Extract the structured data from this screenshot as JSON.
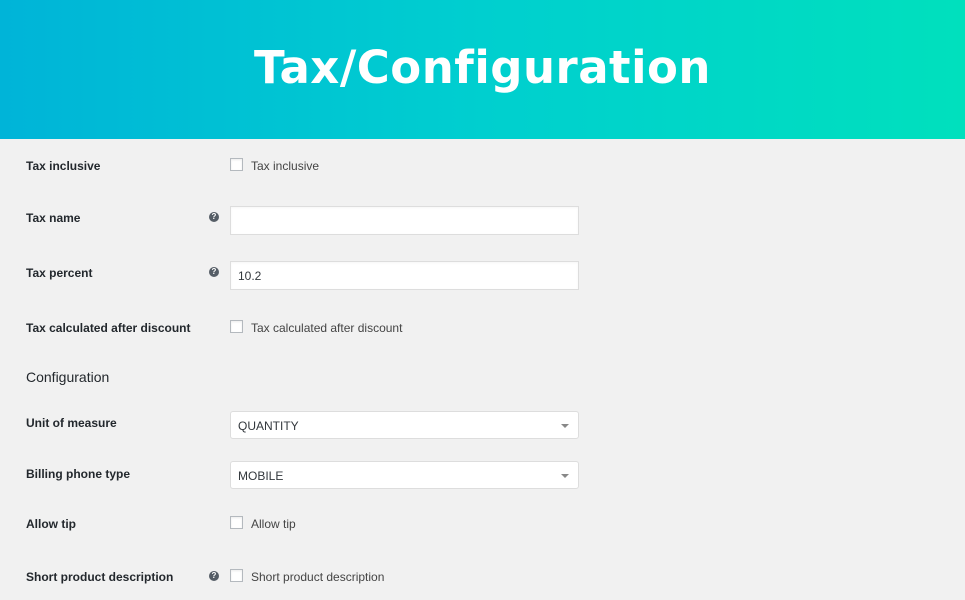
{
  "banner": {
    "title": "Tax/Configuration"
  },
  "fields": {
    "tax_inclusive": {
      "label": "Tax inclusive",
      "checkbox_label": "Tax inclusive"
    },
    "tax_name": {
      "label": "Tax name",
      "value": ""
    },
    "tax_percent": {
      "label": "Tax percent",
      "value": "10.2"
    },
    "tax_after_discount": {
      "label": "Tax calculated after discount",
      "checkbox_label": "Tax calculated after discount"
    },
    "configuration_heading": "Configuration",
    "unit_of_measure": {
      "label": "Unit of measure",
      "selected": "QUANTITY"
    },
    "billing_phone_type": {
      "label": "Billing phone type",
      "selected": "MOBILE"
    },
    "allow_tip": {
      "label": "Allow tip",
      "checkbox_label": "Allow tip"
    },
    "short_product_description": {
      "label": "Short product description",
      "checkbox_label": "Short product description"
    }
  },
  "icons": {
    "help": "help-circle-icon",
    "dropdown": "chevron-down-icon"
  },
  "colors": {
    "banner_start": "#00b4d8",
    "banner_end": "#00e0bd",
    "background": "#f1f1f1"
  }
}
